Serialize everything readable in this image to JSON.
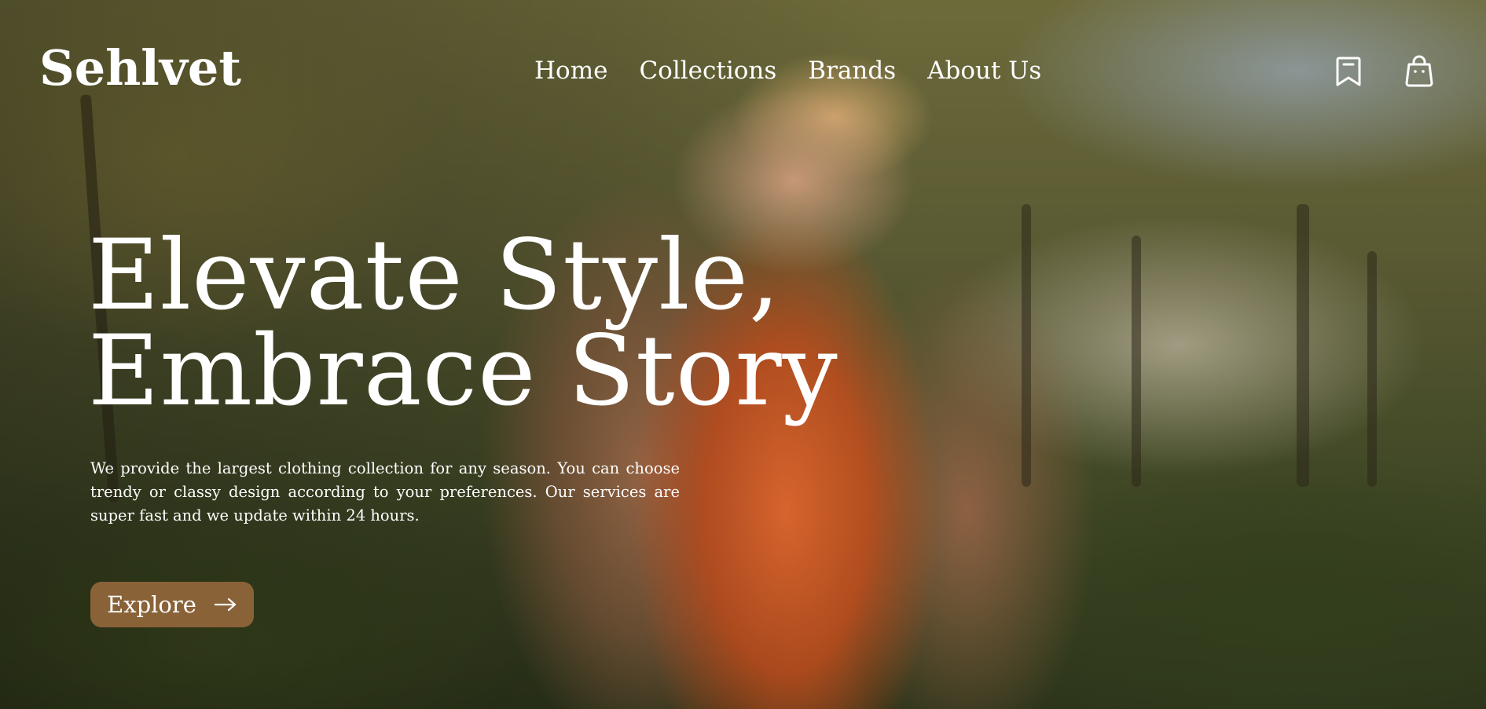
{
  "brand": {
    "logo_text": "Sehlvet"
  },
  "nav": {
    "links": [
      {
        "label": "Home"
      },
      {
        "label": "Collections"
      },
      {
        "label": "Brands"
      },
      {
        "label": "About Us"
      }
    ],
    "icons": [
      "bookmark-icon",
      "shopping-bag-icon"
    ]
  },
  "hero": {
    "headline_line1": "Elevate Style,",
    "headline_line2": "Embrace Story",
    "description": "We provide the largest clothing collection for any season. You can choose trendy or classy design according to your preferences. Our services are super fast and we update within 24 hours.",
    "cta_label": "Explore",
    "cta_icon": "arrow-right-icon"
  },
  "colors": {
    "text": "#ffffff",
    "cta_background": "#8a6238"
  }
}
